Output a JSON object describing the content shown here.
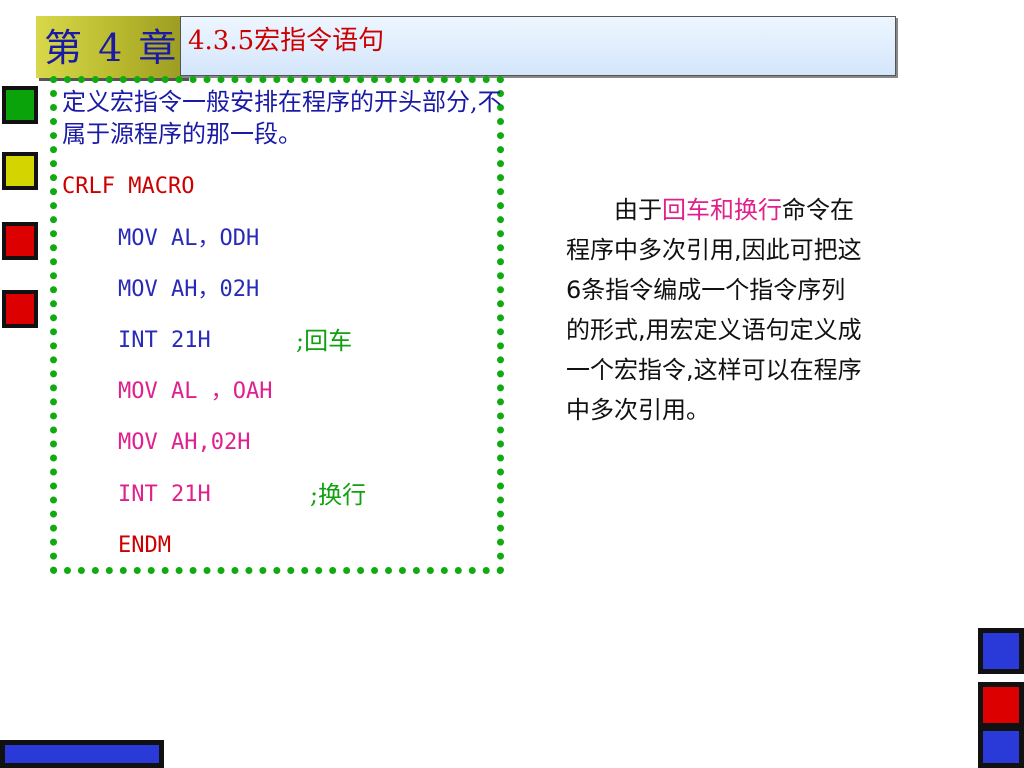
{
  "header": {
    "chapter": "第 4 章",
    "title": "4.3.5宏指令语句"
  },
  "code_box": {
    "intro": "定义宏指令一般安排在程序的开头部分,不属于源程序的那一段。",
    "lines": [
      {
        "text": "CRLF MACRO",
        "comment": ""
      },
      {
        "text": "MOV AL，ODH",
        "comment": ""
      },
      {
        "text": "MOV AH，02H",
        "comment": ""
      },
      {
        "text": "INT   21H",
        "comment": ";回车"
      },
      {
        "text": "MOV AL ，OAH",
        "comment": ""
      },
      {
        "text": "MOV AH,02H",
        "comment": ""
      },
      {
        "text": "INT    21H",
        "comment": ";换行"
      },
      {
        "text": "ENDM",
        "comment": ""
      }
    ]
  },
  "note": {
    "prefix": "由于",
    "highlight": "回车和换行",
    "suffix": "命令在程序中多次引用,因此可把这6条指令编成一个指令序列的形式,用宏定义语句定义成一个宏指令,这样可以在程序中多次引用。"
  },
  "colors": {
    "accent_red": "#cc0000",
    "code_blue": "#2a2ab8",
    "highlight_pink": "#e0208c",
    "frame_green": "#11aa11"
  }
}
